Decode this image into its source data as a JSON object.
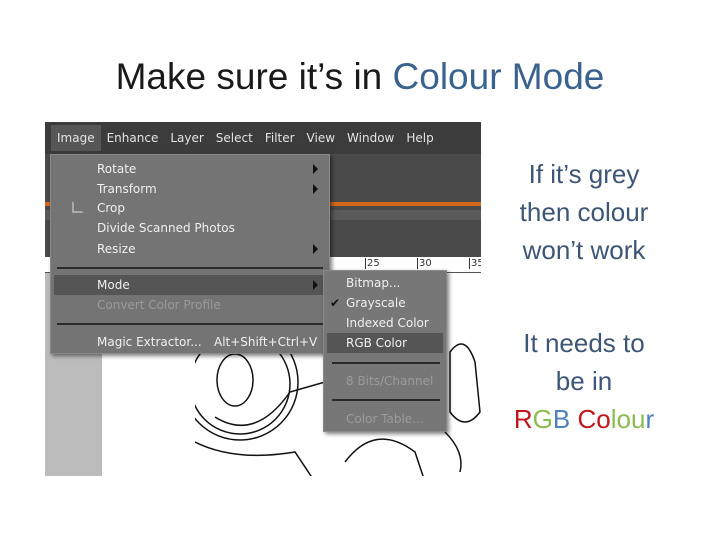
{
  "slide": {
    "title_prefix": "Make sure it’s in ",
    "title_highlight": "Colour Mode",
    "note1": [
      "If it’s grey",
      "then colour",
      "won’t work"
    ],
    "note2": [
      "It needs to",
      "be in"
    ],
    "rgb_letters": [
      {
        "t": "R",
        "c": "#c0161c"
      },
      {
        "t": "G",
        "c": "#8cbc4f"
      },
      {
        "t": "B",
        "c": "#4f81bd"
      },
      {
        "t": " ",
        "c": "#000"
      },
      {
        "t": "C",
        "c": "#c0161c"
      },
      {
        "t": "o",
        "c": "#c0161c"
      },
      {
        "t": "l",
        "c": "#8cbc4f"
      },
      {
        "t": "o",
        "c": "#8cbc4f"
      },
      {
        "t": "u",
        "c": "#8cbc4f"
      },
      {
        "t": "r",
        "c": "#4f81bd"
      }
    ]
  },
  "app": {
    "menubar": [
      "Image",
      "Enhance",
      "Layer",
      "Select",
      "Filter",
      "View",
      "Window",
      "Help"
    ],
    "ruler": [
      "25",
      "30",
      "35"
    ],
    "image_menu": {
      "rotate": "Rotate",
      "transform": "Transform",
      "crop": "Crop",
      "divide": "Divide Scanned Photos",
      "resize": "Resize",
      "mode": "Mode",
      "convert": "Convert Color Profile",
      "magic": "Magic Extractor...",
      "magic_shortcut": "Alt+Shift+Ctrl+V"
    },
    "mode_menu": {
      "bitmap": "Bitmap...",
      "grayscale": "Grayscale",
      "grayscale_checked": true,
      "indexed": "Indexed Color",
      "rgb": "RGB Color",
      "bits": "8 Bits/Channel",
      "table": "Color Table..."
    }
  }
}
